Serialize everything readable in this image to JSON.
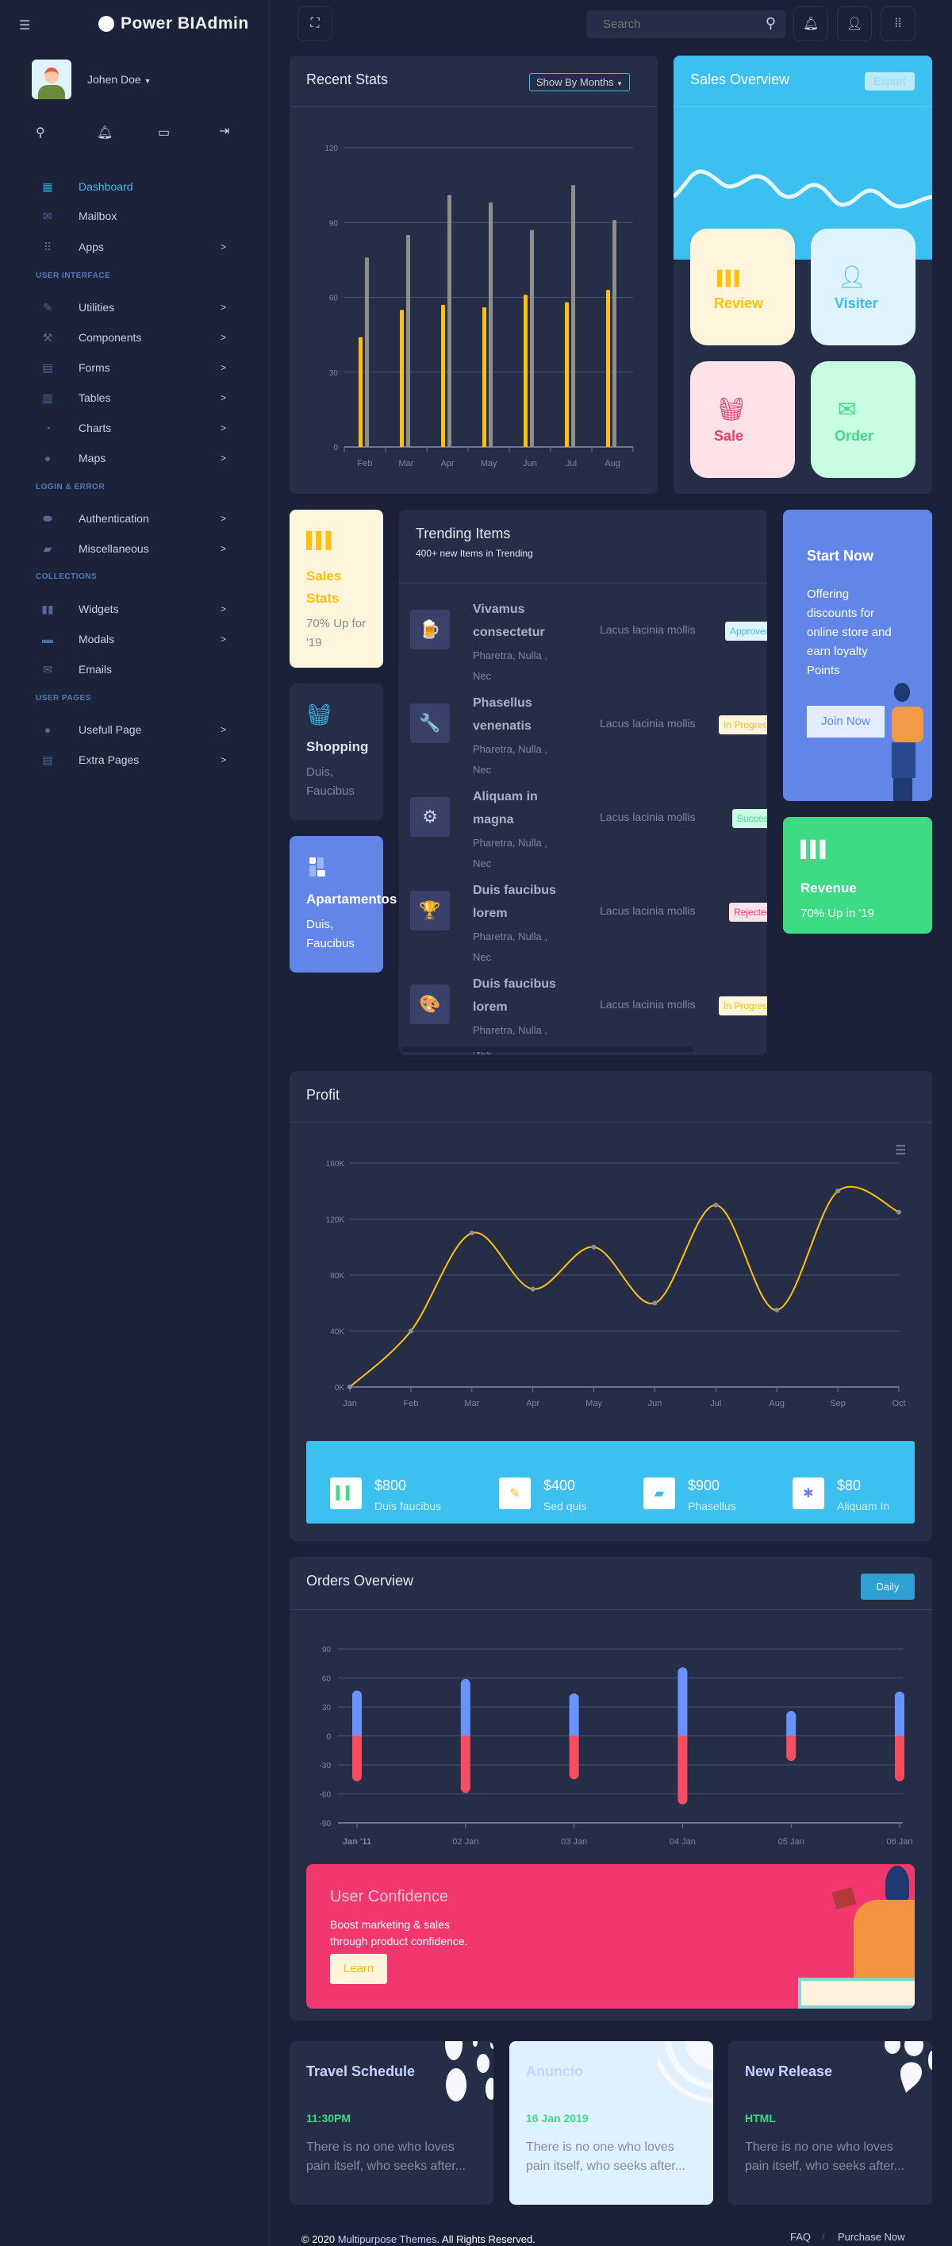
{
  "app": {
    "title": "Power BIAdmin"
  },
  "user": {
    "name": "Johen Doe"
  },
  "sidebar": {
    "items": [
      {
        "type": "item",
        "label": "Dashboard",
        "icon": "dashboard-icon",
        "glyph": "▦",
        "active": true,
        "chevron": false
      },
      {
        "type": "item",
        "label": "Mailbox",
        "icon": "mailbox-icon",
        "glyph": "✉",
        "chevron": false
      },
      {
        "type": "item",
        "label": "Apps",
        "icon": "apps-icon",
        "glyph": "⠿",
        "chevron": true
      },
      {
        "type": "section",
        "label": "USER INTERFACE"
      },
      {
        "type": "item",
        "label": "Utilities",
        "icon": "pencil-icon",
        "glyph": "✎",
        "chevron": true
      },
      {
        "type": "item",
        "label": "Components",
        "icon": "tools-icon",
        "glyph": "⚒",
        "chevron": true
      },
      {
        "type": "item",
        "label": "Forms",
        "icon": "form-icon",
        "glyph": "▤",
        "chevron": true
      },
      {
        "type": "item",
        "label": "Tables",
        "icon": "table-icon",
        "glyph": "▥",
        "chevron": true
      },
      {
        "type": "item",
        "label": "Charts",
        "icon": "pie-chart-icon",
        "glyph": "◔",
        "chevron": true
      },
      {
        "type": "item",
        "label": "Maps",
        "icon": "map-pin-icon",
        "glyph": "●",
        "chevron": true
      },
      {
        "type": "section",
        "label": "LOGIN & ERROR"
      },
      {
        "type": "item",
        "label": "Authentication",
        "icon": "lock-icon",
        "glyph": "⬬",
        "chevron": true
      },
      {
        "type": "item",
        "label": "Miscellaneous",
        "icon": "misc-icon",
        "glyph": "▰",
        "chevron": true
      },
      {
        "type": "section",
        "label": "COLLECTIONS"
      },
      {
        "type": "item",
        "label": "Widgets",
        "icon": "widgets-icon",
        "glyph": "▮▮",
        "chevron": true
      },
      {
        "type": "item",
        "label": "Modals",
        "icon": "modal-icon",
        "glyph": "▬",
        "chevron": true
      },
      {
        "type": "item",
        "label": "Emails",
        "icon": "email-icon",
        "glyph": "✉",
        "chevron": false
      },
      {
        "type": "section",
        "label": "USER PAGES"
      },
      {
        "type": "item",
        "label": "Usefull Page",
        "icon": "user-icon",
        "glyph": "●",
        "chevron": true
      },
      {
        "type": "item",
        "label": "Extra Pages",
        "icon": "clipboard-icon",
        "glyph": "▤",
        "chevron": true
      }
    ],
    "chevron": ">"
  },
  "topbar": {
    "search_placeholder": "Search"
  },
  "recent_stats": {
    "title": "Recent Stats",
    "dropdown": "Show By Months"
  },
  "sales_overview": {
    "title": "Sales Overview",
    "export": "Export",
    "tiles": [
      {
        "label": "Review",
        "color": "#ffc107",
        "bg": "#fff5dc",
        "glyph": "▌▌▌"
      },
      {
        "label": "Visiter",
        "color": "#3cbcf0",
        "bg": "#dff4ff",
        "glyph": "👤"
      },
      {
        "label": "Sale",
        "color": "#f0386b",
        "bg": "#ffe2e7",
        "glyph": "🧺"
      },
      {
        "label": "Order",
        "color": "#3ddc84",
        "bg": "#c9fde3",
        "glyph": "✉"
      }
    ]
  },
  "mini_cards": [
    {
      "title": "Sales Stats",
      "sub": "70% Up for '19"
    },
    {
      "title": "Shopping",
      "sub": "Duis, Faucibus"
    },
    {
      "title": "Apartamentos",
      "sub": "Duis, Faucibus"
    }
  ],
  "trending": {
    "title": "Trending Items",
    "subtitle": "400+ new Items in Trending",
    "rows": [
      {
        "title": "Vivamus consectetur",
        "sub": "Pharetra, Nulla , Nec",
        "mid": "Lacus lacinia mollis",
        "badge": "Approved",
        "icon": "beer-icon",
        "glyph": "🍺",
        "bc": "#3cbcf0",
        "bb": "#dff4ff"
      },
      {
        "title": "Phasellus venenatis",
        "sub": "Pharetra, Nulla , Nec",
        "mid": "Lacus lacinia mollis",
        "badge": "In Progress",
        "icon": "gear-wrench-icon",
        "glyph": "🔧",
        "bc": "#ffc107",
        "bb": "#fff5dc"
      },
      {
        "title": "Aliquam in magna",
        "sub": "Pharetra, Nulla , Nec",
        "mid": "Lacus lacinia mollis",
        "badge": "Success",
        "icon": "gear-check-icon",
        "glyph": "⚙",
        "bc": "#3ddc84",
        "bb": "#c9fde3"
      },
      {
        "title": "Duis faucibus lorem",
        "sub": "Pharetra, Nulla , Nec",
        "mid": "Lacus lacinia mollis",
        "badge": "Rejected",
        "icon": "trophy-icon",
        "glyph": "🏆",
        "bc": "#f0386b",
        "bb": "#ffe2e7"
      },
      {
        "title": "Duis faucibus lorem",
        "sub": "Pharetra, Nulla , Nec",
        "mid": "Lacus lacinia mollis",
        "badge": "In Progress",
        "icon": "palette-icon",
        "glyph": "🎨",
        "bc": "#ffc107",
        "bb": "#fff5dc"
      }
    ]
  },
  "start_now": {
    "title": "Start Now",
    "text": "Offering discounts for online store and earn loyalty Points",
    "button": "Join Now"
  },
  "revenue": {
    "title": "Revenue",
    "sub": "70% Up in '19"
  },
  "profit": {
    "title": "Profit",
    "stats": [
      {
        "value": "$800",
        "label": "Duis faucibus",
        "icon": "books-icon",
        "glyph": "▍▍",
        "c": "#3ddc84"
      },
      {
        "value": "$400",
        "label": "Sed quis",
        "icon": "note-pencil-icon",
        "glyph": "✎",
        "c": "#ffc107"
      },
      {
        "value": "$900",
        "label": "Phasellus",
        "icon": "folder-icon",
        "glyph": "▰",
        "c": "#3cbcf0"
      },
      {
        "value": "$80",
        "label": "Aliquam In",
        "icon": "puzzle-icon",
        "glyph": "✱",
        "c": "#6f7ef0"
      }
    ]
  },
  "orders": {
    "title": "Orders Overview",
    "button": "Daily"
  },
  "confidence": {
    "title": "User Confidence",
    "text1": "Boost marketing & sales",
    "text2": "through product confidence.",
    "button": "Learn"
  },
  "bottom_cards": [
    {
      "title": "Travel Schedule",
      "tag": "11:30PM",
      "text": "There is no one who loves pain itself, who seeks after..."
    },
    {
      "title": "Anuncio",
      "tag": "16 Jan 2019",
      "text": "There is no one who loves pain itself, who seeks after..."
    },
    {
      "title": "New Release",
      "tag": "HTML",
      "text": "There is no one who loves pain itself, who seeks after..."
    }
  ],
  "footer": {
    "copy": "© 2020",
    "brand": "Multipurpose Themes",
    "rights": ". All Rights Reserved.",
    "faq": "FAQ",
    "sep": "/",
    "purchase": "Purchase Now"
  },
  "chart_data": [
    {
      "type": "bar",
      "categories": [
        "Feb",
        "Mar",
        "Apr",
        "May",
        "Jun",
        "Jul",
        "Aug"
      ],
      "series": [
        {
          "values": [
            44,
            55,
            57,
            56,
            61,
            58,
            63
          ],
          "color": "#ffc107"
        },
        {
          "values": [
            76,
            85,
            101,
            98,
            87,
            105,
            91
          ],
          "color": "#8e8e8e"
        }
      ],
      "ylim": [
        0,
        120
      ],
      "yticks": [
        0,
        30,
        60,
        90,
        120
      ],
      "grid": true
    },
    {
      "type": "line",
      "categories": [
        "Jan",
        "Feb",
        "Mar",
        "Apr",
        "May",
        "Jun",
        "Jul",
        "Aug",
        "Sep",
        "Oct"
      ],
      "values": [
        0,
        40,
        110,
        70,
        100,
        60,
        130,
        55,
        140,
        125
      ],
      "ylim": [
        0,
        160
      ],
      "yticks": [
        "0K",
        "40K",
        "80K",
        "120K",
        "160K"
      ],
      "color": "#ffc107",
      "grid": true
    },
    {
      "type": "bar",
      "categories": [
        "Jan '11",
        "02 Jan",
        "03 Jan",
        "04 Jan",
        "05 Jan",
        "06 Jan"
      ],
      "series": [
        {
          "values": [
            42,
            54,
            39,
            66,
            21,
            41
          ],
          "color": "#6993ff"
        },
        {
          "values": [
            -42,
            -54,
            -40,
            -66,
            -21,
            -42
          ],
          "color": "#f64e60"
        }
      ],
      "ylim": [
        -90,
        90
      ],
      "yticks": [
        -90,
        -60,
        -30,
        0,
        30,
        60,
        90
      ],
      "stacked": true,
      "grid": true
    }
  ]
}
